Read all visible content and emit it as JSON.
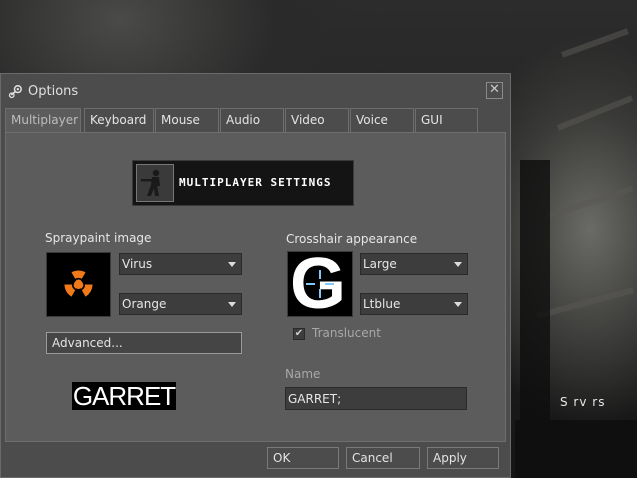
{
  "window": {
    "title": "Options",
    "close_glyph": "✕"
  },
  "tabs": [
    {
      "label": "Multiplayer",
      "active": true
    },
    {
      "label": "Keyboard",
      "active": false
    },
    {
      "label": "Mouse",
      "active": false
    },
    {
      "label": "Audio",
      "active": false
    },
    {
      "label": "Video",
      "active": false
    },
    {
      "label": "Voice",
      "active": false
    },
    {
      "label": "GUI",
      "active": false
    }
  ],
  "banner": {
    "text": "MULTIPLAYER SETTINGS",
    "icon": "soldier-icon"
  },
  "spray": {
    "label": "Spraypaint image",
    "image_combo": "Virus",
    "color_combo": "Orange",
    "advanced_button": "Advanced...",
    "preview_text": "GARRET",
    "icon": "radiation-icon",
    "icon_color": "#f07a1a"
  },
  "crosshair": {
    "label": "Crosshair appearance",
    "size_combo": "Large",
    "color_combo": "Ltblue",
    "translucent_label": "Translucent",
    "translucent_checked": true,
    "preview_letter": "G",
    "crosshair_color": "#7fc9ff"
  },
  "name": {
    "label": "Name",
    "value": "GARRET;"
  },
  "buttons": {
    "ok": "OK",
    "cancel": "Cancel",
    "apply": "Apply"
  },
  "background": {
    "text": "S rv rs"
  }
}
